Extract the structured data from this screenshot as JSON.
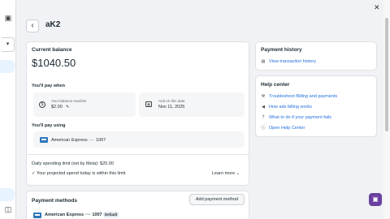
{
  "page": {
    "title": "aK2"
  },
  "balance_card": {
    "heading": "Current balance",
    "amount": "$1040.50",
    "pay_when_label": "You'll pay when",
    "threshold_caption": "Your balance reaches",
    "threshold_value": "$2.00",
    "date_caption": "And on this date",
    "date_value": "Nov 11, 2025",
    "pay_using_label": "You'll pay using",
    "card_name": "American Express ···· 1007",
    "limit_text": "Daily spending limit (set by Meta): $20.00",
    "limit_note": "Your projected spend today is within this limit",
    "learn_more": "Learn more"
  },
  "methods_card": {
    "heading": "Payment methods",
    "add_button": "Add payment method",
    "card_name": "American Express ···· 1007",
    "default_badge": "Default"
  },
  "history_card": {
    "heading": "Payment history",
    "link": "View transaction history"
  },
  "help_center": {
    "heading": "Help center",
    "links": [
      {
        "label": "Troubleshoot Billing and payments",
        "icon": "wrench-icon"
      },
      {
        "label": "How ads billing works",
        "icon": "megaphone-icon"
      },
      {
        "label": "What to do if your payment fails",
        "icon": "question-icon"
      },
      {
        "label": "Open Help Center",
        "icon": "help-circle-icon"
      }
    ]
  },
  "colors": {
    "link": "#216fdb",
    "chat_button": "#6b3fa0",
    "amex": "#2e77bb"
  }
}
